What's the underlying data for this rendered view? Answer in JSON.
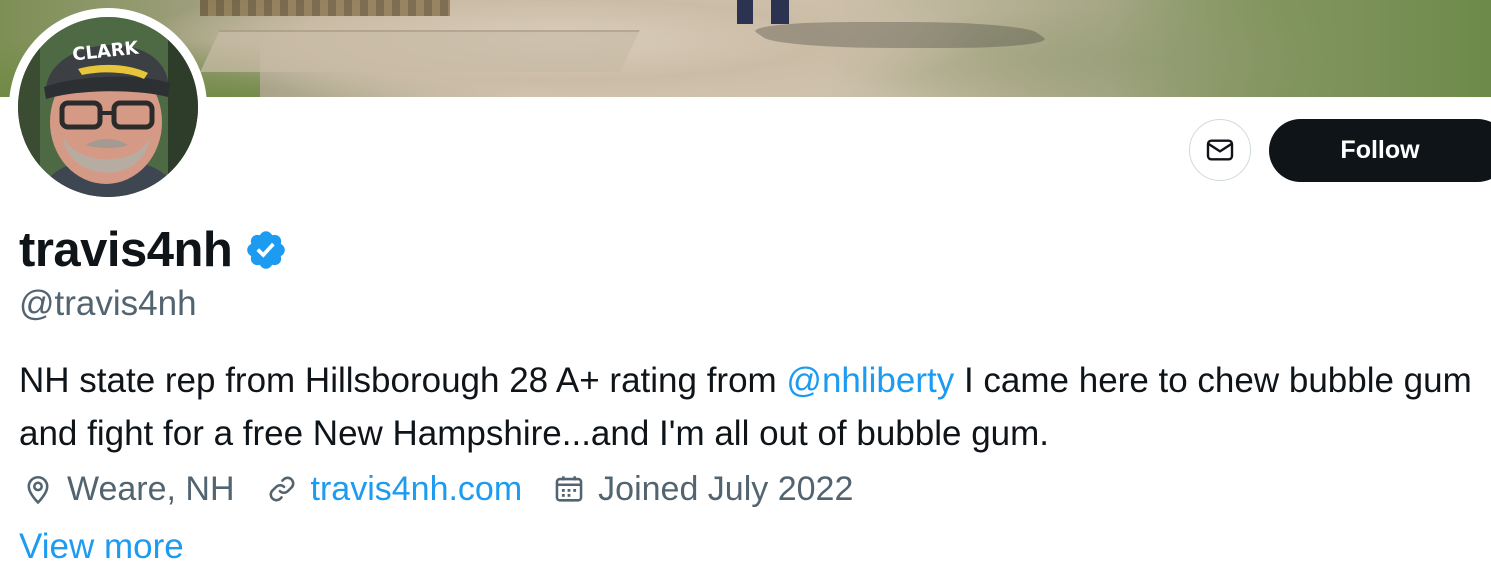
{
  "profile": {
    "display_name": "travis4nh",
    "handle": "@travis4nh",
    "verified": true,
    "verified_badge_color": "#1d9bf0",
    "hat_text": "CLARK",
    "bio_before_mention": "NH state rep from Hillsborough 28 A+ rating from ",
    "bio_mention": "@nhliberty",
    "bio_after_mention": " I came here to chew bubble gum and fight for a free New Hampshire...and I'm all out of bubble gum.",
    "location": "Weare, NH",
    "website": "travis4nh.com",
    "joined": "Joined July 2022",
    "view_more": "View more"
  },
  "actions": {
    "message_icon": "envelope-icon",
    "follow_label": "Follow"
  },
  "colors": {
    "link": "#1d9bf0",
    "secondary_text": "#536471",
    "follow_bg": "#0f1419"
  }
}
